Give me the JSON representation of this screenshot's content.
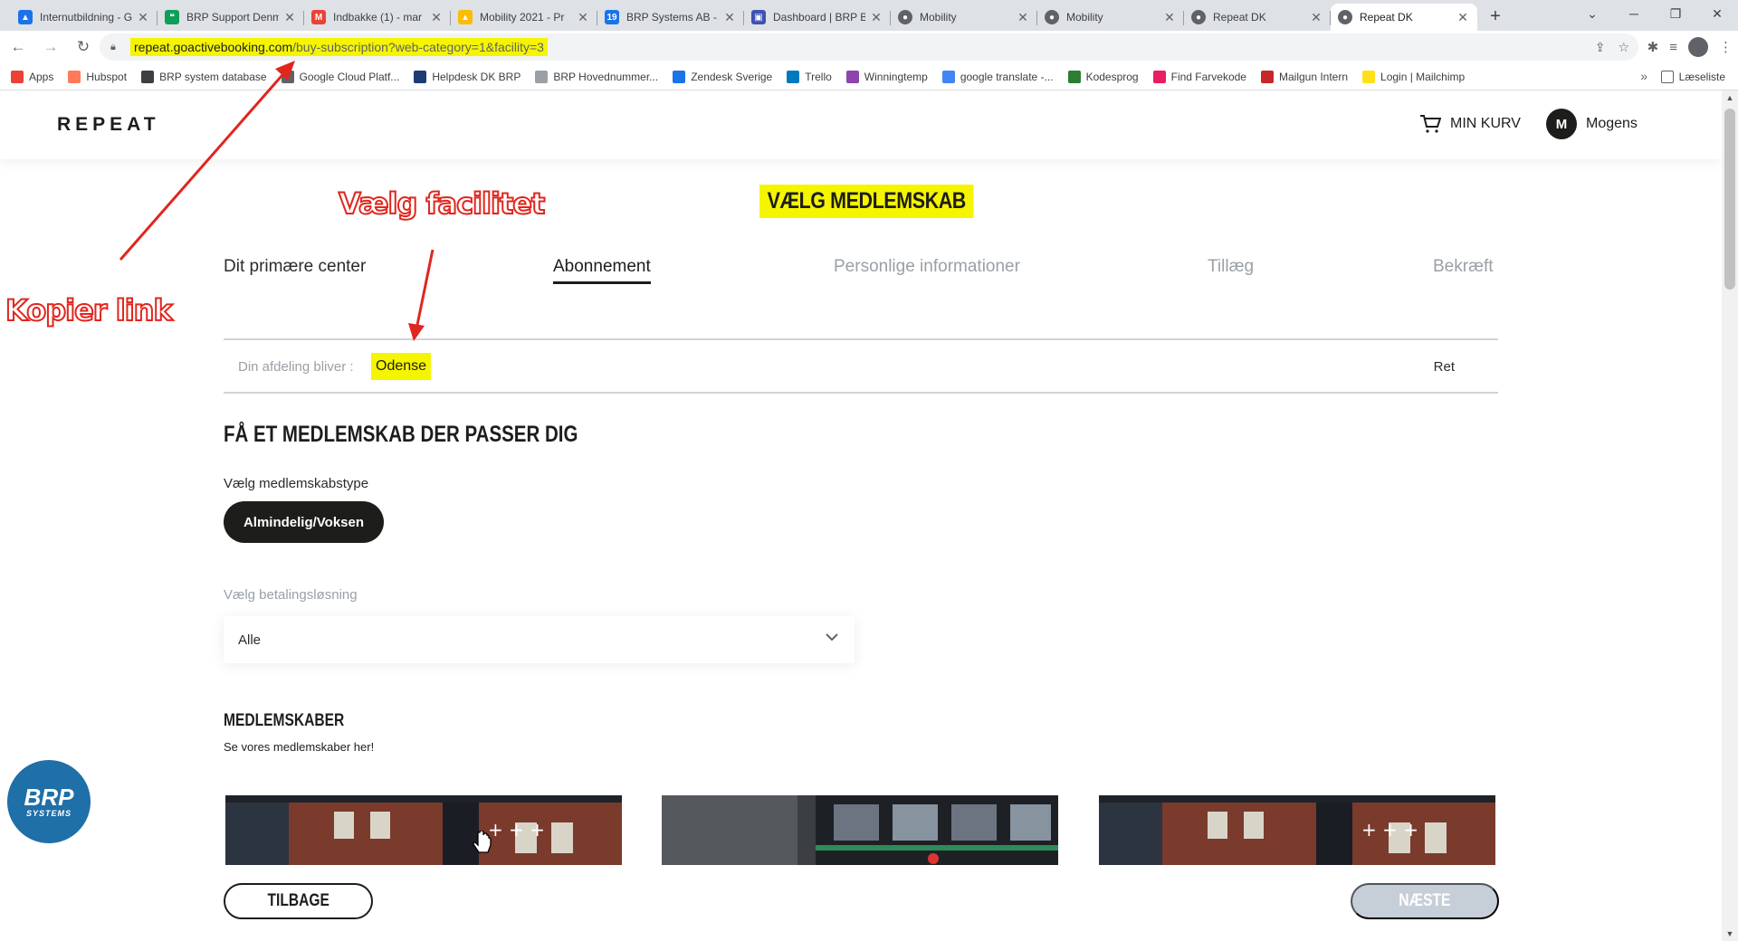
{
  "browser": {
    "tabs": [
      {
        "title": "Internutbildning - G",
        "icon": "drive-icon",
        "color": "#1a73e8"
      },
      {
        "title": "BRP Support Denmark",
        "icon": "hangouts-icon",
        "color": "#0f9d58"
      },
      {
        "title": "Indbakke (1) - mar",
        "icon": "gmail-icon",
        "color": "#ea4335"
      },
      {
        "title": "Mobility 2021 - Pr",
        "icon": "drive-icon",
        "color": "#fbbc04"
      },
      {
        "title": "BRP Systems AB - ",
        "icon": "calendar-icon",
        "color": "#1a73e8"
      },
      {
        "title": "Dashboard | BRP B",
        "icon": "dashboard-icon",
        "color": "#3f51b5"
      },
      {
        "title": "Mobility",
        "icon": "site-icon",
        "color": "#5f6368"
      },
      {
        "title": "Mobility",
        "icon": "site-icon",
        "color": "#5f6368"
      },
      {
        "title": "Repeat DK",
        "icon": "site-icon",
        "color": "#5f6368"
      },
      {
        "title": "Repeat DK",
        "icon": "site-icon",
        "color": "#5f6368"
      }
    ],
    "url_host": "repeat.goactivebooking.com",
    "url_path": "/buy-subscription?web-category=1&facility=3",
    "bookmarks": [
      {
        "label": "Apps",
        "color": "#ea4335"
      },
      {
        "label": "Hubspot",
        "color": "#ff7a59"
      },
      {
        "label": "BRP system database",
        "color": "#3c4043"
      },
      {
        "label": "Google Cloud Platf...",
        "color": "#5f6368"
      },
      {
        "label": "Helpdesk DK BRP",
        "color": "#1f3b73"
      },
      {
        "label": "BRP Hovednummer...",
        "color": "#9aa0a6"
      },
      {
        "label": "Zendesk Sverige",
        "color": "#1a73e8"
      },
      {
        "label": "Trello",
        "color": "#0079bf"
      },
      {
        "label": "Winningtemp",
        "color": "#8e44ad"
      },
      {
        "label": "google translate -...",
        "color": "#4285f4"
      },
      {
        "label": "Kodesprog",
        "color": "#2e7d32"
      },
      {
        "label": "Find Farvekode",
        "color": "#e91e63"
      },
      {
        "label": "Mailgun Intern",
        "color": "#c62828"
      },
      {
        "label": "Login | Mailchimp",
        "color": "#ffe01b"
      }
    ],
    "reading_list": "Læseliste"
  },
  "header": {
    "logo": "REPEAT",
    "cart_label": "MIN KURV",
    "user_initial": "M",
    "user_name": "Mogens"
  },
  "heading": "VÆLG MEDLEMSKAB",
  "steps": [
    {
      "label": "Dit primære center",
      "state": "done"
    },
    {
      "label": "Abonnement",
      "state": "active"
    },
    {
      "label": "Personlige informationer",
      "state": "todo"
    },
    {
      "label": "Tillæg",
      "state": "todo"
    },
    {
      "label": "Bekræft",
      "state": "todo"
    }
  ],
  "facility": {
    "label": "Din afdeling bliver :",
    "value": "Odense",
    "edit": "Ret"
  },
  "section_title": "FÅ ET MEDLEMSKAB DER PASSER DIG",
  "membership_type": {
    "label": "Vælg medlemskabstype",
    "selected": "Almindelig/Voksen"
  },
  "payment": {
    "label": "Vælg betalingsløsning",
    "selected": "Alle"
  },
  "memberships": {
    "title": "MEDLEMSKABER",
    "subtitle": "Se vores medlemskaber her!"
  },
  "footer": {
    "back": "TILBAGE",
    "next": "NÆSTE"
  },
  "brp": {
    "main": "BRP",
    "sub": "SYSTEMS"
  },
  "annotations": {
    "copy_link": "Kopier link",
    "choose_facility": "Vælg facilitet"
  },
  "colors": {
    "highlight": "#f5f500",
    "annotation": "#e0261e",
    "brand_dark": "#1d1d1b",
    "brp_blue": "#1f6fa8",
    "next_disabled": "#c6cfd8"
  }
}
